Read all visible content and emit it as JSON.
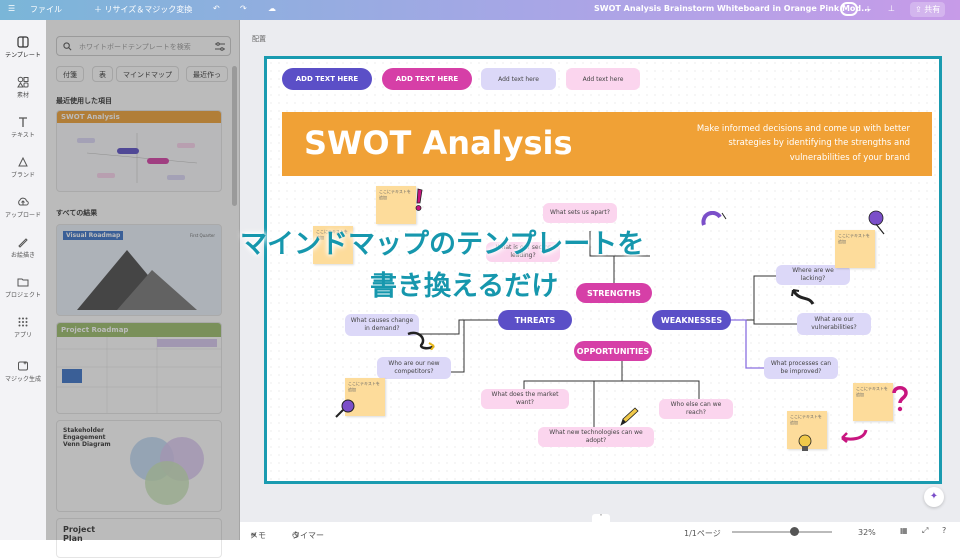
{
  "topbar": {
    "menu_icon": "menu-icon",
    "file_label": "ファイル",
    "resize_label": "＋ リサイズ＆マジック変換",
    "title": "SWOT Analysis Brainstorm Whiteboard in Orange Pink Mod...",
    "share_label": "共有"
  },
  "rail": {
    "items": [
      {
        "label": "テンプレート",
        "icon": "template-icon"
      },
      {
        "label": "素材",
        "icon": "elements-icon"
      },
      {
        "label": "テキスト",
        "icon": "text-icon"
      },
      {
        "label": "ブランド",
        "icon": "brand-icon"
      },
      {
        "label": "アップロード",
        "icon": "upload-icon"
      },
      {
        "label": "お絵描き",
        "icon": "draw-icon"
      },
      {
        "label": "プロジェクト",
        "icon": "folder-icon"
      },
      {
        "label": "アプリ",
        "icon": "apps-icon"
      },
      {
        "label": "マジック生成",
        "icon": "magic-icon"
      }
    ]
  },
  "panel": {
    "search_placeholder": "ホワイトボードテンプレートを検索",
    "chips": [
      "付箋",
      "表",
      "マインドマップ",
      "最近作っ"
    ],
    "recent_label": "最近使用した項目",
    "all_label": "すべての結果",
    "thumbs": [
      {
        "title": "SWOT Analysis"
      },
      {
        "title": "Visual Roadmap",
        "subtitle": "First Quarter"
      },
      {
        "title": "Project Roadmap"
      },
      {
        "title": "Stakeholder Engagement Venn Diagram"
      },
      {
        "title": "Project Plan"
      }
    ]
  },
  "canvas_header": "配置",
  "template": {
    "buttons": [
      {
        "label": "ADD TEXT HERE",
        "color": "#5b4fc7",
        "text_color": "#ffffff"
      },
      {
        "label": "ADD TEXT HERE",
        "color": "#d63fa7",
        "text_color": "#ffffff"
      },
      {
        "label": "Add text here",
        "color": "#dcd8f8",
        "text_color": "#444444"
      },
      {
        "label": "Add text here",
        "color": "#fbd5ee",
        "text_color": "#444444"
      }
    ],
    "banner_title": "SWOT Analysis",
    "banner_subtitle": "Make informed decisions and come up with better strategies by identifying the strengths and vulnerabilities of your brand",
    "nodes": {
      "strengths": "STRENGTHS",
      "threats": "THREATS",
      "weaknesses": "WEAKNESSES",
      "opportunities": "OPPORTUNITIES"
    },
    "questions": [
      "What sets us apart?",
      "What is our sector leading?",
      "Where are we lacking?",
      "What are our vulnerabilities?",
      "What processes can be improved?",
      "What causes change in demand?",
      "Who are our new competitors?",
      "What does the market want?",
      "Who else can we reach?",
      "What new technologies can we adopt?"
    ],
    "sticky_text": "ここにテキストを追加"
  },
  "overlay": {
    "line1": "マインドマップのテンプレートを",
    "line2": "書き換えるだけ"
  },
  "bottombar": {
    "notes": "メモ",
    "timer": "タイマー",
    "page": "1/1ページ",
    "zoom": "32%"
  },
  "colors": {
    "accent": "#1a9bb0",
    "banner": "#f0a136",
    "purple": "#5b4fc7",
    "pink": "#d63fa7"
  }
}
